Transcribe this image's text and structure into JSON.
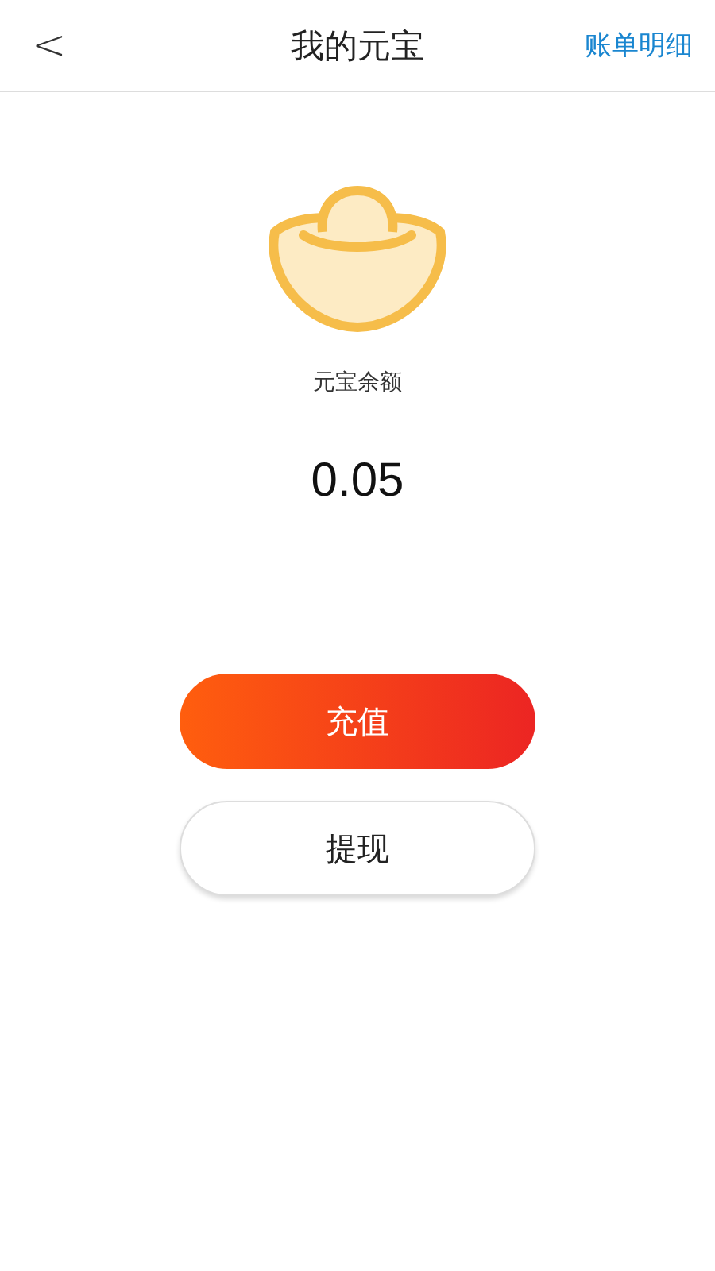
{
  "header": {
    "back": "<",
    "title": "我的元宝",
    "action": "账单明细"
  },
  "balance": {
    "label": "元宝余额",
    "amount": "0.05"
  },
  "buttons": [
    {
      "label": "充值",
      "kind": "primary"
    },
    {
      "label": "提现",
      "kind": "secondary"
    }
  ]
}
